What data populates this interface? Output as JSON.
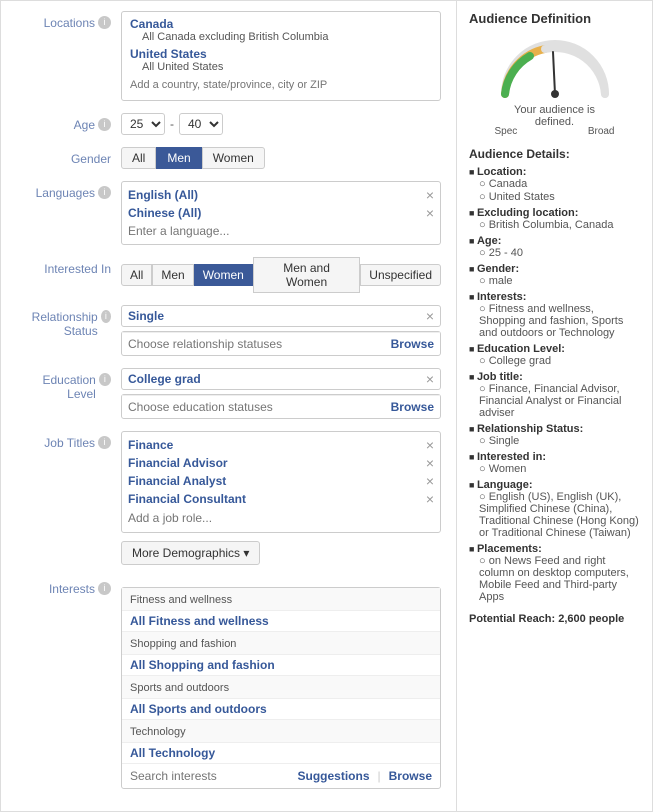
{
  "labels": {
    "locations": "Locations",
    "age": "Age",
    "gender": "Gender",
    "languages": "Languages",
    "interested_in": "Interested In",
    "relationship_status": "Relationship Status",
    "education_level": "Education Level",
    "job_titles": "Job Titles",
    "interests": "Interests"
  },
  "locations": {
    "canada": "Canada",
    "canada_sub": "All Canada excluding British Columbia",
    "us": "United States",
    "us_sub": "All United States",
    "placeholder": "Add a country, state/province, city or ZIP"
  },
  "age": {
    "from": "25",
    "to": "40",
    "dash": "-"
  },
  "gender": {
    "buttons": [
      "All",
      "Men",
      "Women"
    ],
    "active": "Men"
  },
  "languages": {
    "items": [
      "English (All)",
      "Chinese (All)"
    ],
    "placeholder": "Enter a language..."
  },
  "interested_in": {
    "buttons": [
      "All",
      "Men",
      "Women",
      "Men and Women",
      "Unspecified"
    ],
    "active": "Women"
  },
  "relationship_status": {
    "value": "Single",
    "placeholder": "Choose relationship statuses",
    "browse": "Browse"
  },
  "education_level": {
    "value": "College grad",
    "placeholder": "Choose education statuses",
    "browse": "Browse"
  },
  "job_titles": {
    "items": [
      "Finance",
      "Financial Advisor",
      "Financial Analyst",
      "Financial Consultant"
    ],
    "placeholder": "Add a job role..."
  },
  "more_demographics": "More Demographics ▾",
  "interests_data": {
    "categories": [
      {
        "label": "Fitness and wellness",
        "item": "All Fitness and wellness"
      },
      {
        "label": "Shopping and fashion",
        "item": "All Shopping and fashion"
      },
      {
        "label": "Sports and outdoors",
        "item": "All Sports and outdoors"
      },
      {
        "label": "Technology",
        "item": "All Technology"
      }
    ],
    "search_placeholder": "Search interests",
    "suggestions": "Suggestions",
    "browse": "Browse"
  },
  "right_panel": {
    "title": "Audience Definition",
    "gauge_label": "Your audience is defined.",
    "spec_label": "Spec",
    "broad_label": "Broad",
    "details_title": "Audience Details:",
    "details": {
      "location_label": "Location:",
      "location_items": [
        "Canada",
        "United States"
      ],
      "excluding_label": "Excluding location:",
      "excluding_items": [
        "British Columbia, Canada"
      ],
      "age_label": "Age:",
      "age_items": [
        "25 - 40"
      ],
      "gender_label": "Gender:",
      "gender_items": [
        "male"
      ],
      "interests_label": "Interests:",
      "interests_items": [
        "Fitness and wellness, Shopping and fashion, Sports and outdoors or Technology"
      ],
      "education_label": "Education Level:",
      "education_items": [
        "College grad"
      ],
      "job_label": "Job title:",
      "job_items": [
        "Finance, Financial Advisor, Financial Analyst or Financial adviser"
      ],
      "relationship_label": "Relationship Status:",
      "relationship_items": [
        "Single"
      ],
      "interested_label": "Interested in:",
      "interested_items": [
        "Women"
      ],
      "language_label": "Language:",
      "language_items": [
        "English (US), English (UK), Simplified Chinese (China), Traditional Chinese (Hong Kong) or Traditional Chinese (Taiwan)"
      ],
      "placements_label": "Placements:",
      "placements_items": [
        "on News Feed and right column on desktop computers, Mobile Feed and Third-party Apps"
      ]
    },
    "potential_reach": "Potential Reach:",
    "potential_reach_value": "2,600 people"
  }
}
